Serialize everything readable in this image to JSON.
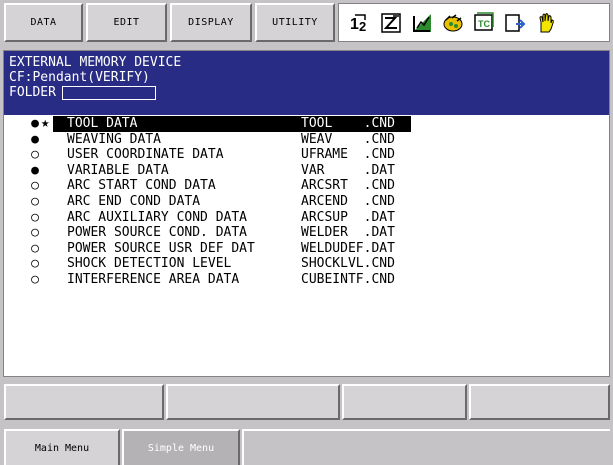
{
  "menu": {
    "data": "DATA",
    "edit": "EDIT",
    "display": "DISPLAY",
    "utility": "UTILITY"
  },
  "status_icons": [
    "multi-group-icon",
    "teach-mode-icon",
    "step-graph-icon",
    "operation-icon",
    "screen-icon",
    "program-icon",
    "hand-icon"
  ],
  "header": {
    "title": "EXTERNAL MEMORY DEVICE",
    "device": "CF:Pendant(VERIFY)",
    "folder_label": "FOLDER",
    "folder_value": ""
  },
  "files": [
    {
      "mark": "●",
      "star": "★",
      "name": "TOOL DATA",
      "file": "TOOL    .CND",
      "selected": true
    },
    {
      "mark": "●",
      "star": "",
      "name": "WEAVING DATA",
      "file": "WEAV    .CND",
      "selected": false
    },
    {
      "mark": "○",
      "star": "",
      "name": "USER COORDINATE DATA",
      "file": "UFRAME  .CND",
      "selected": false
    },
    {
      "mark": "●",
      "star": "",
      "name": "VARIABLE DATA",
      "file": "VAR     .DAT",
      "selected": false
    },
    {
      "mark": "○",
      "star": "",
      "name": "ARC START COND DATA",
      "file": "ARCSRT  .CND",
      "selected": false
    },
    {
      "mark": "○",
      "star": "",
      "name": "ARC END COND DATA",
      "file": "ARCEND  .CND",
      "selected": false
    },
    {
      "mark": "○",
      "star": "",
      "name": "ARC AUXILIARY COND DATA",
      "file": "ARCSUP  .DAT",
      "selected": false
    },
    {
      "mark": "○",
      "star": "",
      "name": "POWER SOURCE COND. DATA",
      "file": "WELDER  .DAT",
      "selected": false
    },
    {
      "mark": "○",
      "star": "",
      "name": "POWER SOURCE USR DEF DAT",
      "file": "WELDUDEF.DAT",
      "selected": false
    },
    {
      "mark": "○",
      "star": "",
      "name": "SHOCK DETECTION LEVEL",
      "file": "SHOCKLVL.CND",
      "selected": false
    },
    {
      "mark": "○",
      "star": "",
      "name": "INTERFERENCE AREA DATA",
      "file": "CUBEINTF.CND",
      "selected": false
    }
  ],
  "tabs": {
    "main": "Main Menu",
    "simple": "Simple Menu"
  },
  "colors": {
    "header_bg": "#292c84",
    "selection_bg": "#000000",
    "panel_bg": "#ffffff",
    "chrome_bg": "#c6c3c6"
  }
}
